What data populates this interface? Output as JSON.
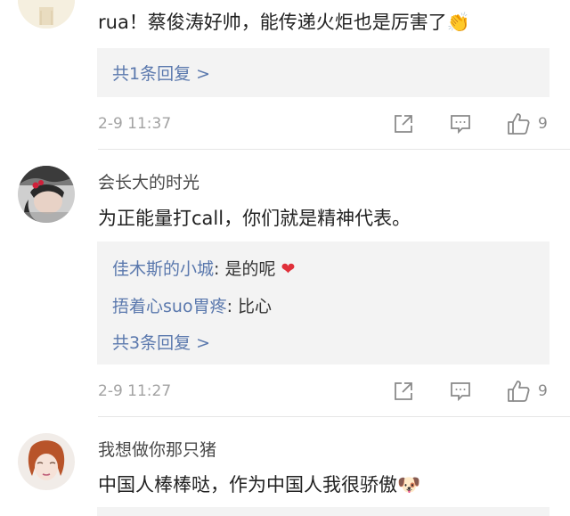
{
  "comments": [
    {
      "text": "rua！蔡俊涛好帅，能传递火炬也是厉害了",
      "emoji": "👏",
      "more_replies": "共1条回复 >",
      "time": "2-9 11:37",
      "likes": "9"
    },
    {
      "user": "会长大的时光",
      "text": "为正能量打call，你们就是精神代表。",
      "replies": [
        {
          "name": "佳木斯的小城",
          "text": ": 是的呢",
          "emoji": "❤"
        },
        {
          "name": "捂着心suo胃疼",
          "text": ": 比心"
        }
      ],
      "more_replies": "共3条回复 >",
      "time": "2-9 11:27",
      "likes": "9"
    },
    {
      "user": "我想做你那只猪",
      "text": "中国人棒棒哒，作为中国人我很骄傲",
      "emoji": "🐶"
    }
  ],
  "icons": {
    "share": "share-icon",
    "comment": "comment-icon",
    "like": "thumbs-up-icon"
  },
  "colors": {
    "link": "#5a78ad",
    "time": "#a3a3a3",
    "reply_bg": "#f3f3f3"
  }
}
